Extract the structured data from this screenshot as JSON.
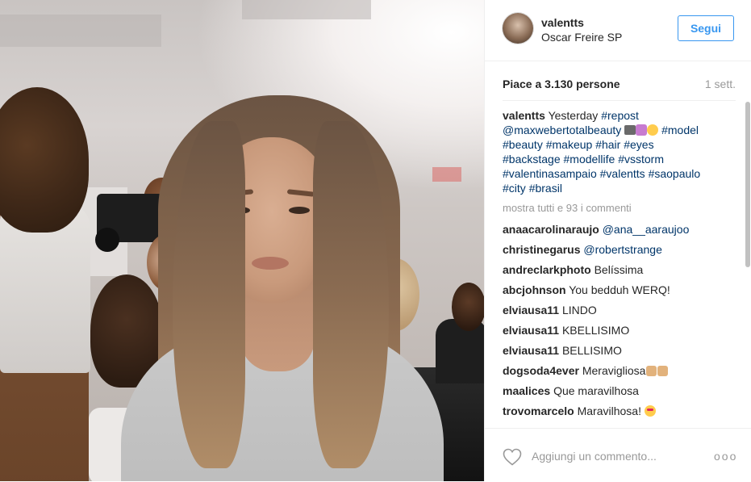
{
  "post": {
    "username": "valentts",
    "location": "Oscar Freire SP",
    "follow_label": "Segui",
    "likes": "Piace a 3.130 persone",
    "time": "1 sett.",
    "caption": {
      "user": "valentts",
      "text_1": "Yesterday",
      "tag_1": "#repost",
      "mention": "@maxwebertotalbeauty",
      "tags_line_2": [
        "#model"
      ],
      "tags_line_3": [
        "#beauty",
        "#makeup",
        "#hair",
        "#eyes"
      ],
      "tags_line_4": [
        "#backstage",
        "#modellife",
        "#vsstorm"
      ],
      "tags_line_5": [
        "#valentinasampaio",
        "#valentts",
        "#saopaulo"
      ],
      "tags_line_6": [
        "#city",
        "#brasil"
      ]
    },
    "show_all": "mostra tutti e 93 i commenti",
    "comments": [
      {
        "user": "anaacarolinaraujo",
        "mention": "@ana__aaraujoo",
        "text": ""
      },
      {
        "user": "christinegarus",
        "mention": "@robertstrange",
        "text": ""
      },
      {
        "user": "andreclarkphoto",
        "mention": "",
        "text": "Belíssima"
      },
      {
        "user": "abcjohnson",
        "mention": "",
        "text": "You bedduh WERQ!"
      },
      {
        "user": "elviausa11",
        "mention": "",
        "text": "LINDO"
      },
      {
        "user": "elviausa11",
        "mention": "",
        "text": "KBELLISIMO"
      },
      {
        "user": "elviausa11",
        "mention": "",
        "text": "BELLISIMO"
      },
      {
        "user": "dogsoda4ever",
        "mention": "",
        "text": "Meravigliosa"
      },
      {
        "user": "maalices",
        "mention": "",
        "text": "Que maravilhosa"
      },
      {
        "user": "trovomarcelo",
        "mention": "",
        "text": "Maravilhosa!"
      }
    ],
    "comment_placeholder": "Aggiungi un commento...",
    "more_label": "ooo",
    "colors": {
      "accent": "#3897f0",
      "hashtag": "#003569",
      "muted": "#999999",
      "border": "#efefef"
    },
    "icons": {
      "heart": "heart-outline-icon",
      "more": "more-options-icon"
    }
  }
}
